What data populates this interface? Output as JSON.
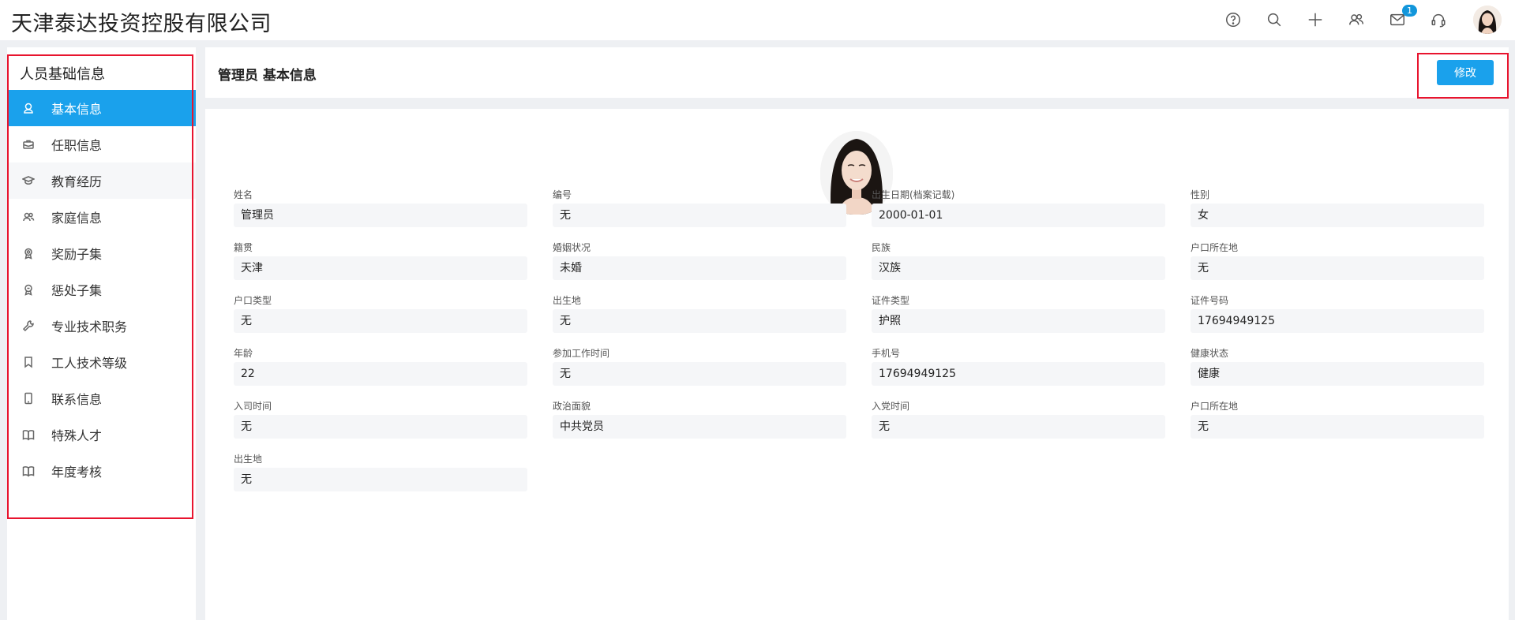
{
  "app": {
    "company": "天津泰达投资控股有限公司"
  },
  "topbar": {
    "icons": [
      "help-icon",
      "search-icon",
      "plus-icon",
      "users-icon",
      "mail-icon",
      "headset-icon"
    ],
    "mail_badge": "1"
  },
  "sidebar": {
    "title": "人员基础信息",
    "items": [
      {
        "label": "基本信息",
        "icon": "user-icon",
        "active": true
      },
      {
        "label": "任职信息",
        "icon": "briefcase-icon"
      },
      {
        "label": "教育经历",
        "icon": "graduation-cap-icon"
      },
      {
        "label": "家庭信息",
        "icon": "family-icon"
      },
      {
        "label": "奖励子集",
        "icon": "award-icon"
      },
      {
        "label": "惩处子集",
        "icon": "penalty-icon"
      },
      {
        "label": "专业技术职务",
        "icon": "wrench-icon"
      },
      {
        "label": "工人技术等级",
        "icon": "bookmark-icon"
      },
      {
        "label": "联系信息",
        "icon": "phone-icon"
      },
      {
        "label": "特殊人才",
        "icon": "book-icon"
      },
      {
        "label": "年度考核",
        "icon": "book-icon"
      }
    ]
  },
  "header": {
    "title": "管理员 基本信息",
    "edit_label": "修改"
  },
  "accent_color": "#1aa1ec",
  "fields": [
    {
      "label": "姓名",
      "value": "管理员"
    },
    {
      "label": "编号",
      "value": "无"
    },
    {
      "label": "出生日期(档案记载)",
      "value": "2000-01-01"
    },
    {
      "label": "性别",
      "value": "女"
    },
    {
      "label": "籍贯",
      "value": "天津"
    },
    {
      "label": "婚姻状况",
      "value": "未婚"
    },
    {
      "label": "民族",
      "value": "汉族"
    },
    {
      "label": "户口所在地",
      "value": "无"
    },
    {
      "label": "户口类型",
      "value": "无"
    },
    {
      "label": "出生地",
      "value": "无"
    },
    {
      "label": "证件类型",
      "value": "护照"
    },
    {
      "label": "证件号码",
      "value": "17694949125"
    },
    {
      "label": "年龄",
      "value": "22"
    },
    {
      "label": "参加工作时间",
      "value": "无"
    },
    {
      "label": "手机号",
      "value": "17694949125"
    },
    {
      "label": "健康状态",
      "value": "健康"
    },
    {
      "label": "入司时间",
      "value": "无"
    },
    {
      "label": "政治面貌",
      "value": "中共党员"
    },
    {
      "label": "入党时间",
      "value": "无"
    },
    {
      "label": "户口所在地",
      "value": "无"
    },
    {
      "label": "出生地",
      "value": "无"
    }
  ]
}
